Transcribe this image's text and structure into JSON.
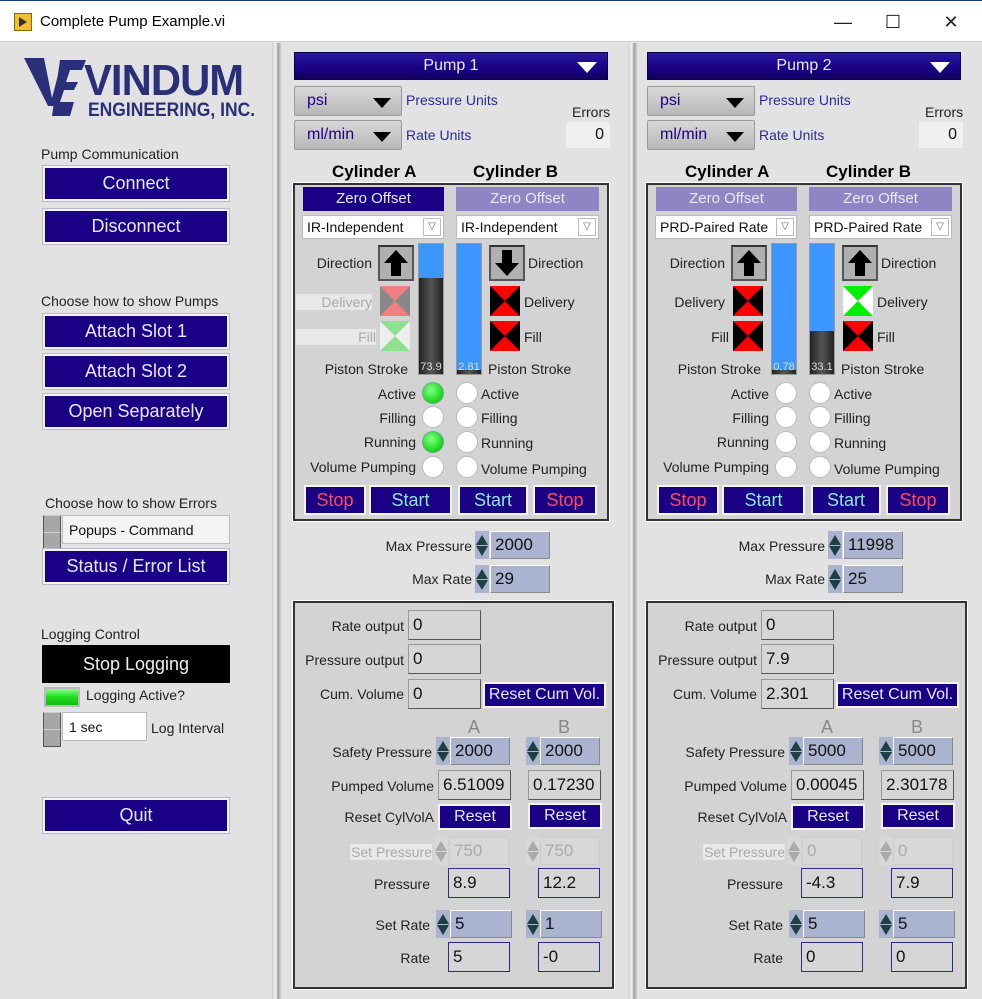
{
  "window": {
    "title": "Complete Pump Example.vi",
    "minimize": "—",
    "maximize": "☐",
    "close": "✕"
  },
  "logo": {
    "top": "VINDUM",
    "bottom": "ENGINEERING, INC.",
    "color": "#2a2f7a"
  },
  "sidebar": {
    "comm_label": "Pump Communication",
    "connect": "Connect",
    "disconnect": "Disconnect",
    "show_pumps_label": "Choose how to show Pumps",
    "attach1": "Attach Slot 1",
    "attach2": "Attach Slot 2",
    "open_sep": "Open Separately",
    "show_errors_label": "Choose how to show Errors",
    "errors_mode": "Popups - Command",
    "status_list": "Status / Error List",
    "logging_label": "Logging Control",
    "stop_logging": "Stop Logging",
    "logging_active_label": "Logging Active?",
    "logging_active": true,
    "log_interval": "1 sec",
    "log_interval_label": "Log Interval",
    "quit": "Quit"
  },
  "colors": {
    "accent": "#1a0085",
    "button_text": "#e8e8ff",
    "stop_text": "#ff4a5a",
    "start_text": "#8fe6d8",
    "stroke_blue": "#3b96ff",
    "led_on": "#22dd22",
    "bowtie_red": "#ff0000",
    "bowtie_green": "#00ee00"
  },
  "pumps": [
    {
      "name": "Pump 1",
      "pressure_units": "psi",
      "pressure_units_label": "Pressure Units",
      "rate_units": "ml/min",
      "rate_units_label": "Rate Units",
      "errors_label": "Errors",
      "errors": "0",
      "cylA": {
        "title": "Cylinder A",
        "zero_offset": "Zero Offset",
        "zero_active": true,
        "mode": "IR-Independent",
        "direction_label": "Direction",
        "direction": "up",
        "delivery_label": "Delivery",
        "delivery_state": "dim-red",
        "fill_label": "Fill",
        "fill_state": "dim-green",
        "stroke_label": "Piston Stroke",
        "stroke_value": "73.9",
        "stroke_pct": 73.9,
        "active": true,
        "filling": false,
        "running": true,
        "volume_pumping": false
      },
      "cylB": {
        "title": "Cylinder B",
        "zero_offset": "Zero Offset",
        "zero_active": false,
        "mode": "IR-Independent",
        "direction_label": "Direction",
        "direction": "down",
        "delivery_label": "Delivery",
        "delivery_state": "red",
        "fill_label": "Fill",
        "fill_state": "red",
        "stroke_label": "Piston Stroke",
        "stroke_value": "2.81",
        "stroke_pct": 2.81,
        "active": false,
        "filling": false,
        "running": false,
        "volume_pumping": false
      },
      "status_labels": {
        "active": "Active",
        "filling": "Filling",
        "running": "Running",
        "volume_pumping": "Volume Pumping"
      },
      "stop": "Stop",
      "start": "Start",
      "max_pressure_label": "Max Pressure",
      "max_pressure": "2000",
      "max_rate_label": "Max Rate",
      "max_rate": "29",
      "rate_output_label": "Rate output",
      "rate_output": "0",
      "pressure_output_label": "Pressure output",
      "pressure_output": "0",
      "cum_volume_label": "Cum. Volume",
      "cum_volume": "0",
      "reset_cum": "Reset Cum Vol.",
      "col_a": "A",
      "col_b": "B",
      "safety_pressure_label": "Safety Pressure",
      "safety_a": "2000",
      "safety_b": "2000",
      "pumped_volume_label": "Pumped Volume",
      "pumped_a": "6.51009",
      "pumped_b": "0.17230",
      "reset_cyl_label": "Reset CylVolA",
      "reset": "Reset",
      "set_pressure_label": "Set Pressure",
      "set_pressure_a": "750",
      "set_pressure_b": "750",
      "pressure_label": "Pressure",
      "pressure_a": "8.9",
      "pressure_b": "12.2",
      "set_rate_label": "Set Rate",
      "set_rate_a": "5",
      "set_rate_b": "1",
      "rate_label": "Rate",
      "rate_a": "5",
      "rate_b": "-0"
    },
    {
      "name": "Pump 2",
      "pressure_units": "psi",
      "pressure_units_label": "Pressure Units",
      "rate_units": "ml/min",
      "rate_units_label": "Rate Units",
      "errors_label": "Errors",
      "errors": "0",
      "cylA": {
        "title": "Cylinder A",
        "zero_offset": "Zero Offset",
        "zero_active": false,
        "mode": "PRD-Paired Rate",
        "direction_label": "Direction",
        "direction": "up",
        "delivery_label": "Delivery",
        "delivery_state": "red",
        "fill_label": "Fill",
        "fill_state": "red",
        "stroke_label": "Piston Stroke",
        "stroke_value": "0.78",
        "stroke_pct": 0.78,
        "active": false,
        "filling": false,
        "running": false,
        "volume_pumping": false
      },
      "cylB": {
        "title": "Cylinder B",
        "zero_offset": "Zero Offset",
        "zero_active": false,
        "mode": "PRD-Paired Rate",
        "direction_label": "Direction",
        "direction": "up",
        "delivery_label": "Delivery",
        "delivery_state": "green",
        "fill_label": "Fill",
        "fill_state": "red",
        "stroke_label": "Piston Stroke",
        "stroke_value": "33.1",
        "stroke_pct": 33.1,
        "active": false,
        "filling": false,
        "running": false,
        "volume_pumping": false
      },
      "status_labels": {
        "active": "Active",
        "filling": "Filling",
        "running": "Running",
        "volume_pumping": "Volume Pumping"
      },
      "stop": "Stop",
      "start": "Start",
      "max_pressure_label": "Max Pressure",
      "max_pressure": "11998",
      "max_rate_label": "Max Rate",
      "max_rate": "25",
      "rate_output_label": "Rate output",
      "rate_output": "0",
      "pressure_output_label": "Pressure output",
      "pressure_output": "7.9",
      "cum_volume_label": "Cum. Volume",
      "cum_volume": "2.301",
      "reset_cum": "Reset Cum Vol.",
      "col_a": "A",
      "col_b": "B",
      "safety_pressure_label": "Safety Pressure",
      "safety_a": "5000",
      "safety_b": "5000",
      "pumped_volume_label": "Pumped Volume",
      "pumped_a": "0.00045",
      "pumped_b": "2.30178",
      "reset_cyl_label": "Reset CylVolA",
      "reset": "Reset",
      "set_pressure_label": "Set Pressure",
      "set_pressure_a": "0",
      "set_pressure_b": "0",
      "pressure_label": "Pressure",
      "pressure_a": "-4.3",
      "pressure_b": "7.9",
      "set_rate_label": "Set Rate",
      "set_rate_a": "5",
      "set_rate_b": "5",
      "rate_label": "Rate",
      "rate_a": "0",
      "rate_b": "0"
    }
  ]
}
